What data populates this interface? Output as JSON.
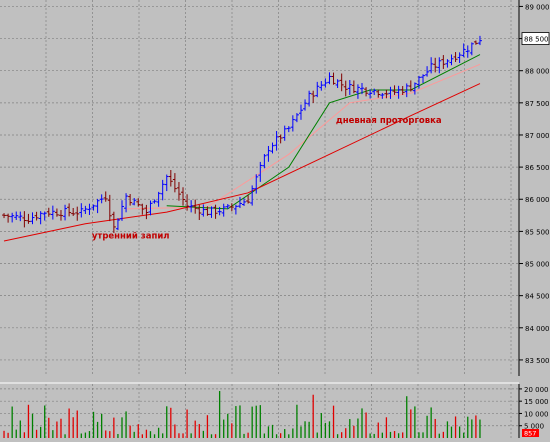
{
  "colors": {
    "background": "#c0c0c0",
    "grid": "#808080",
    "bar_up": "#0000ff",
    "bar_down": "#800000",
    "ma_fast": "#ff9999",
    "ma_mid": "#008000",
    "ma_slow": "#e00000",
    "annotation": "#c00000",
    "vol_up": "#008000",
    "vol_down": "#e00000",
    "last_price_box": "#ffffff"
  },
  "chart_data": [
    {
      "type": "bar",
      "subtype": "ohlc",
      "title": "",
      "ylim": [
        83250,
        89100
      ],
      "yticks": [
        "89 000",
        "88 500",
        "88 000",
        "87 500",
        "87 000",
        "86 500",
        "86 000",
        "85 500",
        "85 000",
        "84 500",
        "84 000",
        "83 500"
      ],
      "ytick_values": [
        89000,
        88500,
        88000,
        87500,
        87000,
        86500,
        86000,
        85500,
        85000,
        84500,
        84000,
        83500
      ],
      "last_price_label": "88 500",
      "last_price": 88500,
      "grid": true,
      "x_count": 118,
      "key_closes": [
        {
          "i": 0,
          "close": 85750
        },
        {
          "i": 6,
          "close": 85700
        },
        {
          "i": 10,
          "close": 85800
        },
        {
          "i": 19,
          "close": 85800
        },
        {
          "i": 25,
          "close": 86050
        },
        {
          "i": 27,
          "close": 85550
        },
        {
          "i": 30,
          "close": 86050
        },
        {
          "i": 35,
          "close": 85800
        },
        {
          "i": 40,
          "close": 86350
        },
        {
          "i": 45,
          "close": 85900
        },
        {
          "i": 50,
          "close": 85800
        },
        {
          "i": 55,
          "close": 85850
        },
        {
          "i": 60,
          "close": 86000
        },
        {
          "i": 65,
          "close": 86800
        },
        {
          "i": 70,
          "close": 87100
        },
        {
          "i": 75,
          "close": 87600
        },
        {
          "i": 80,
          "close": 87900
        },
        {
          "i": 84,
          "close": 87750
        },
        {
          "i": 90,
          "close": 87700
        },
        {
          "i": 95,
          "close": 87650
        },
        {
          "i": 100,
          "close": 87750
        },
        {
          "i": 105,
          "close": 88050
        },
        {
          "i": 110,
          "close": 88200
        },
        {
          "i": 114,
          "close": 88350
        },
        {
          "i": 117,
          "close": 88500
        }
      ],
      "moving_averages": [
        {
          "name": "",
          "color_key": "ma_fast",
          "points": [
            {
              "i": 30,
              "v": 85850
            },
            {
              "i": 50,
              "v": 85880
            },
            {
              "i": 70,
              "v": 86700
            },
            {
              "i": 85,
              "v": 87500
            },
            {
              "i": 100,
              "v": 87650
            },
            {
              "i": 117,
              "v": 88100
            }
          ]
        },
        {
          "name": "",
          "color_key": "ma_mid",
          "points": [
            {
              "i": 40,
              "v": 85900
            },
            {
              "i": 55,
              "v": 85850
            },
            {
              "i": 70,
              "v": 86500
            },
            {
              "i": 80,
              "v": 87500
            },
            {
              "i": 90,
              "v": 87700
            },
            {
              "i": 100,
              "v": 87700
            },
            {
              "i": 117,
              "v": 88250
            }
          ]
        },
        {
          "name": "",
          "color_key": "ma_slow",
          "points": [
            {
              "i": 0,
              "v": 85350
            },
            {
              "i": 20,
              "v": 85620
            },
            {
              "i": 40,
              "v": 85800
            },
            {
              "i": 60,
              "v": 86100
            },
            {
              "i": 80,
              "v": 86700
            },
            {
              "i": 100,
              "v": 87300
            },
            {
              "i": 117,
              "v": 87800
            }
          ]
        }
      ],
      "annotations": [
        {
          "text": "утренний запил",
          "at_i": 27,
          "at_v": 85450
        },
        {
          "text": "дневная проторговка",
          "at_i": 87,
          "at_v": 87250
        }
      ]
    },
    {
      "type": "bar",
      "subtype": "volume",
      "ylim": [
        0,
        22000
      ],
      "yticks": [
        "20 000",
        "15 000",
        "10 000",
        "5 000"
      ],
      "ytick_values": [
        20000,
        15000,
        10000,
        5000
      ],
      "last_value_label": "857",
      "grid": true,
      "x_count": 118
    }
  ]
}
